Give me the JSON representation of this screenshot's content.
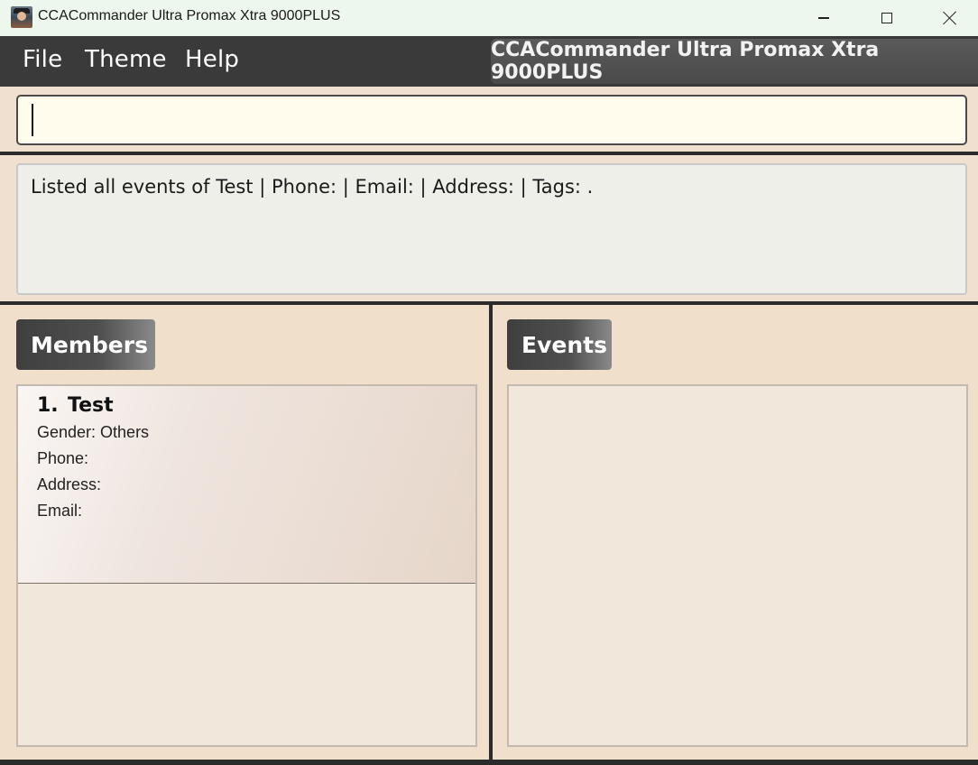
{
  "window": {
    "title": "CCACommander Ultra Promax Xtra 9000PLUS",
    "controls": [
      "minimize-icon",
      "maximize-icon",
      "close-icon"
    ]
  },
  "menubar": {
    "items": [
      {
        "label": "File"
      },
      {
        "label": "Theme"
      },
      {
        "label": "Help"
      }
    ],
    "banner": "CCACommander Ultra Promax Xtra 9000PLUS"
  },
  "command": {
    "value": "",
    "placeholder": ""
  },
  "result": {
    "text": "Listed all events of Test | Phone:  | Email:  | Address:  | Tags: ."
  },
  "members": {
    "header": "Members",
    "items": [
      {
        "index": "1.",
        "name": "Test",
        "gender": "Gender: Others",
        "phone": "Phone:",
        "address": "Address:",
        "email": "Email:"
      }
    ]
  },
  "events": {
    "header": "Events",
    "items": []
  },
  "colors": {
    "menubar": "#3a3a3a",
    "panel_background": "#efe0cf",
    "command_input": "#fffbed",
    "result_box": "#efefe9"
  }
}
